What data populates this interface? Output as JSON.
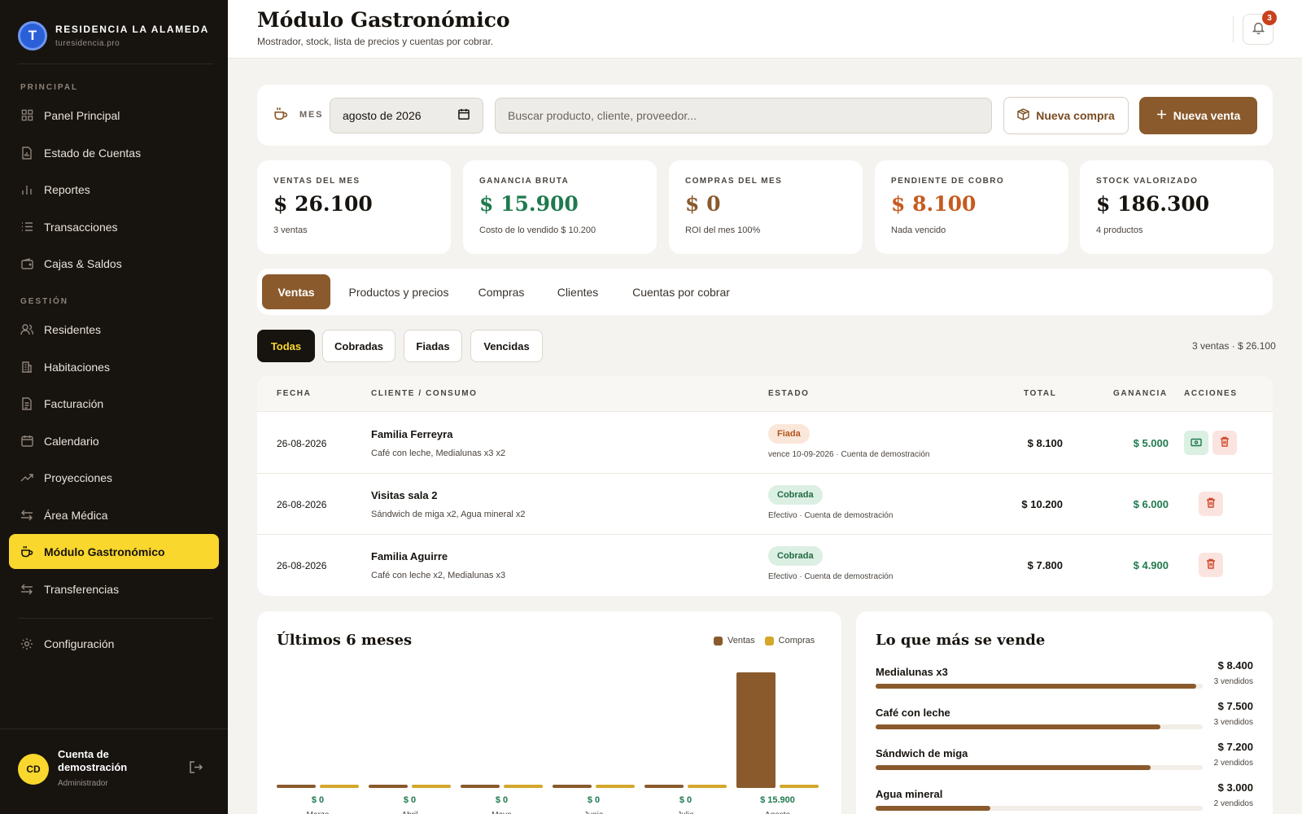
{
  "brand": {
    "title": "RESIDENCIA LA ALAMEDA",
    "subtitle": "turesidencia.pro",
    "logo_letter": "T"
  },
  "sidebar": {
    "section_principal": "PRINCIPAL",
    "section_gestion": "GESTIÓN",
    "principal_items": [
      {
        "label": "Panel Principal",
        "icon": "grid-icon"
      },
      {
        "label": "Estado de Cuentas",
        "icon": "document-icon"
      },
      {
        "label": "Reportes",
        "icon": "bar-chart-icon"
      },
      {
        "label": "Transacciones",
        "icon": "list-icon"
      },
      {
        "label": "Cajas & Saldos",
        "icon": "wallet-icon"
      }
    ],
    "gestion_items": [
      {
        "label": "Residentes",
        "icon": "users-icon"
      },
      {
        "label": "Habitaciones",
        "icon": "building-icon"
      },
      {
        "label": "Facturación",
        "icon": "invoice-icon"
      },
      {
        "label": "Calendario",
        "icon": "calendar-icon"
      },
      {
        "label": "Proyecciones",
        "icon": "trend-icon"
      },
      {
        "label": "Área Médica",
        "icon": "transfer-icon"
      },
      {
        "label": "Módulo Gastronómico",
        "icon": "cup-icon",
        "active": true
      },
      {
        "label": "Transferencias",
        "icon": "transfer-icon"
      }
    ],
    "config_label": "Configuración",
    "user": {
      "initials": "CD",
      "name": "Cuenta de demostración",
      "role": "Administrador"
    }
  },
  "header": {
    "title": "Módulo Gastronómico",
    "subtitle": "Mostrador, stock, lista de precios y cuentas por cobrar.",
    "notifications": "3"
  },
  "toolbar": {
    "month_label": "MES",
    "month_value": "agosto de 2026",
    "search_placeholder": "Buscar producto, cliente, proveedor...",
    "new_purchase": "Nueva compra",
    "new_sale": "Nueva venta"
  },
  "stats": [
    {
      "label": "VENTAS DEL MES",
      "value": "$ 26.100",
      "sub": "3 ventas",
      "color": "#17130f"
    },
    {
      "label": "GANANCIA BRUTA",
      "value": "$ 15.900",
      "sub": "Costo de lo vendido $ 10.200",
      "color": "#1f7a4d"
    },
    {
      "label": "COMPRAS DEL MES",
      "value": "$ 0",
      "sub": "ROI del mes 100%",
      "color": "#8a5a2c"
    },
    {
      "label": "PENDIENTE DE COBRO",
      "value": "$ 8.100",
      "sub": "Nada vencido",
      "color": "#c65a1e"
    },
    {
      "label": "STOCK VALORIZADO",
      "value": "$ 186.300",
      "sub": "4 productos",
      "color": "#17130f"
    }
  ],
  "tabs": [
    "Ventas",
    "Productos y precios",
    "Compras",
    "Clientes",
    "Cuentas por cobrar"
  ],
  "filters": [
    "Todas",
    "Cobradas",
    "Fiadas",
    "Vencidas"
  ],
  "filter_summary": "3 ventas · $ 26.100",
  "table": {
    "headers": {
      "date": "FECHA",
      "client": "CLIENTE / CONSUMO",
      "status": "ESTADO",
      "total": "TOTAL",
      "gain": "GANANCIA",
      "actions": "ACCIONES"
    },
    "rows": [
      {
        "date": "26-08-2026",
        "client": "Familia Ferreyra",
        "items": "Café con leche, Medialunas x3 x2",
        "status": "Fiada",
        "note": "vence 10-09-2026 · Cuenta de demostración",
        "total": "$ 8.100",
        "gain": "$ 5.000"
      },
      {
        "date": "26-08-2026",
        "client": "Visitas sala 2",
        "items": "Sándwich de miga x2, Agua mineral x2",
        "status": "Cobrada",
        "note": "Efectivo · Cuenta de demostración",
        "total": "$ 10.200",
        "gain": "$ 6.000"
      },
      {
        "date": "26-08-2026",
        "client": "Familia Aguirre",
        "items": "Café con leche x2, Medialunas x3",
        "status": "Cobrada",
        "note": "Efectivo · Cuenta de demostración",
        "total": "$ 7.800",
        "gain": "$ 4.900"
      }
    ]
  },
  "chart_section": {
    "title": "Últimos 6 meses",
    "legend_sales": "Ventas",
    "legend_purchases": "Compras",
    "color_sales": "#8a5a2c",
    "color_purchases": "#d4a72c"
  },
  "chart_data": {
    "type": "bar",
    "categories": [
      "Marzo",
      "Abril",
      "Mayo",
      "Junio",
      "Julio",
      "Agosto"
    ],
    "series": [
      {
        "name": "Ventas",
        "values": [
          0,
          0,
          0,
          0,
          0,
          26100
        ]
      },
      {
        "name": "Compras",
        "values": [
          0,
          0,
          0,
          0,
          0,
          0
        ]
      }
    ],
    "value_labels": [
      "$ 0",
      "$ 0",
      "$ 0",
      "$ 0",
      "$ 0",
      "$ 15.900"
    ],
    "ylim": [
      0,
      26100
    ],
    "grid": false,
    "legend": "top-right"
  },
  "top_sellers": {
    "title": "Lo que más se vende",
    "items": [
      {
        "name": "Medialunas x3",
        "amount": "$ 8.400",
        "count": "3 vendidos",
        "share": 0.98
      },
      {
        "name": "Café con leche",
        "amount": "$ 7.500",
        "count": "3 vendidos",
        "share": 0.87
      },
      {
        "name": "Sándwich de miga",
        "amount": "$ 7.200",
        "count": "2 vendidos",
        "share": 0.84
      },
      {
        "name": "Agua mineral",
        "amount": "$ 3.000",
        "count": "2 vendidos",
        "share": 0.35
      }
    ]
  }
}
